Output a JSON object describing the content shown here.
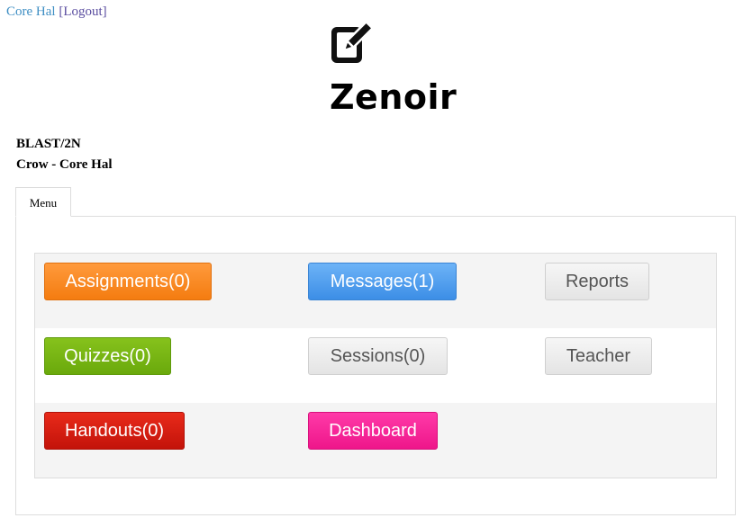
{
  "topnav": {
    "user": "Core Hal",
    "logout": "[Logout]"
  },
  "brand": {
    "name": "Zenoir",
    "icon": "edit-square-icon"
  },
  "course": {
    "code": "BLAST/2N",
    "section": "Crow - Core Hal"
  },
  "tabs": [
    {
      "label": "Menu"
    }
  ],
  "menu": {
    "assignments": "Assignments(0)",
    "messages": "Messages(1)",
    "reports": "Reports",
    "quizzes": "Quizzes(0)",
    "sessions": "Sessions(0)",
    "teacher": "Teacher",
    "handouts": "Handouts(0)",
    "dashboard": "Dashboard"
  },
  "colors": {
    "assignments": "#f47c10",
    "messages": "#3c8ee6",
    "quizzes": "#6aa90c",
    "handouts": "#c3130a",
    "dashboard": "#ee168a",
    "neutral": "#e4e4e4"
  }
}
